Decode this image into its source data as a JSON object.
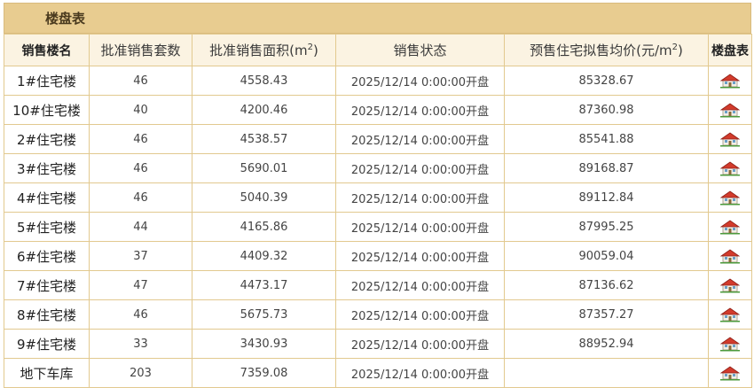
{
  "panel": {
    "title": "楼盘表"
  },
  "columns": {
    "building": "销售楼名",
    "units": "批准销售套数",
    "area_prefix": "批准销售面积(m",
    "area_suffix": ")",
    "status": "销售状态",
    "price_prefix": "预售住宅拟售均价(元/m",
    "price_suffix": ")",
    "plan": "楼盘表",
    "sup": "2"
  },
  "rows": [
    {
      "building": "1#住宅楼",
      "units": "46",
      "area": "4558.43",
      "status": "2025/12/14 0:00:00开盘",
      "price": "85328.67",
      "icon": "house-icon"
    },
    {
      "building": "10#住宅楼",
      "units": "40",
      "area": "4200.46",
      "status": "2025/12/14 0:00:00开盘",
      "price": "87360.98",
      "icon": "house-icon"
    },
    {
      "building": "2#住宅楼",
      "units": "46",
      "area": "4538.57",
      "status": "2025/12/14 0:00:00开盘",
      "price": "85541.88",
      "icon": "house-icon"
    },
    {
      "building": "3#住宅楼",
      "units": "46",
      "area": "5690.01",
      "status": "2025/12/14 0:00:00开盘",
      "price": "89168.87",
      "icon": "house-icon"
    },
    {
      "building": "4#住宅楼",
      "units": "46",
      "area": "5040.39",
      "status": "2025/12/14 0:00:00开盘",
      "price": "89112.84",
      "icon": "house-icon"
    },
    {
      "building": "5#住宅楼",
      "units": "44",
      "area": "4165.86",
      "status": "2025/12/14 0:00:00开盘",
      "price": "87995.25",
      "icon": "house-icon"
    },
    {
      "building": "6#住宅楼",
      "units": "37",
      "area": "4409.32",
      "status": "2025/12/14 0:00:00开盘",
      "price": "90059.04",
      "icon": "house-icon"
    },
    {
      "building": "7#住宅楼",
      "units": "47",
      "area": "4473.17",
      "status": "2025/12/14 0:00:00开盘",
      "price": "87136.62",
      "icon": "house-icon"
    },
    {
      "building": "8#住宅楼",
      "units": "46",
      "area": "5675.73",
      "status": "2025/12/14 0:00:00开盘",
      "price": "87357.27",
      "icon": "house-icon"
    },
    {
      "building": "9#住宅楼",
      "units": "33",
      "area": "3430.93",
      "status": "2025/12/14 0:00:00开盘",
      "price": "88952.94",
      "icon": "house-icon"
    },
    {
      "building": "地下车库",
      "units": "203",
      "area": "7359.08",
      "status": "2025/12/14 0:00:00开盘",
      "price": "",
      "icon": "house-icon"
    }
  ],
  "colors": {
    "header_bar": "#e8cc90",
    "border": "#e2c98f",
    "head_bg": "#fbf3e2"
  }
}
